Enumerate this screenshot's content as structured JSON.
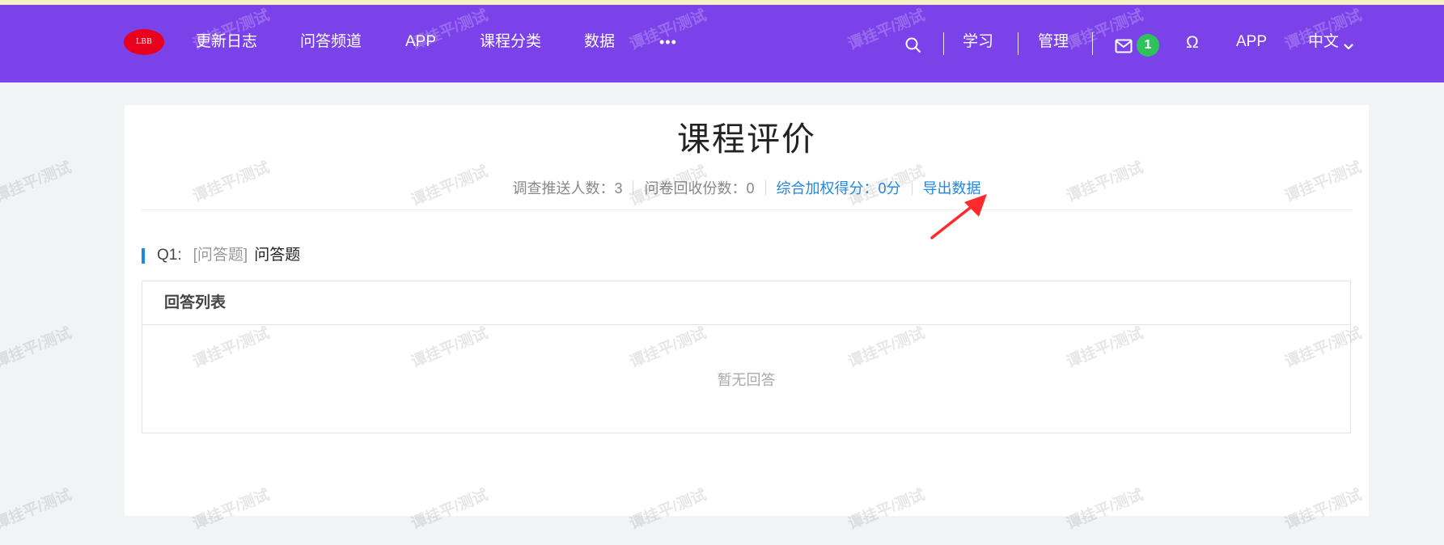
{
  "nav": {
    "logo_text": "LBB",
    "links": [
      "更新日志",
      "问答频道",
      "APP",
      "课程分类",
      "数据"
    ],
    "more_label": "•••",
    "right_links": {
      "learn": "学习",
      "manage": "管理",
      "app": "APP",
      "language": "中文"
    },
    "message_count": "1",
    "special_char_label": "Ω"
  },
  "page": {
    "title": "课程评价",
    "stats": {
      "pushed": "调查推送人数：3",
      "collected": "问卷回收份数：0",
      "score": "综合加权得分：0分",
      "export": "导出数据"
    },
    "question": {
      "number": "Q1:",
      "type": "[问答题]",
      "title": "问答题"
    },
    "answers": {
      "header": "回答列表",
      "empty_text": "暂无回答"
    }
  },
  "watermark_text": "谭挂平/测试",
  "colors": {
    "nav_bg": "#7b42ea",
    "accent_blue": "#1e88e5",
    "badge_green": "#2fc25b",
    "logo_red": "#e8001c",
    "annotation_arrow": "#ff2a2a"
  },
  "icons": [
    "search-icon",
    "mail-icon",
    "chevron-down-icon",
    "annotation-arrow-icon"
  ]
}
